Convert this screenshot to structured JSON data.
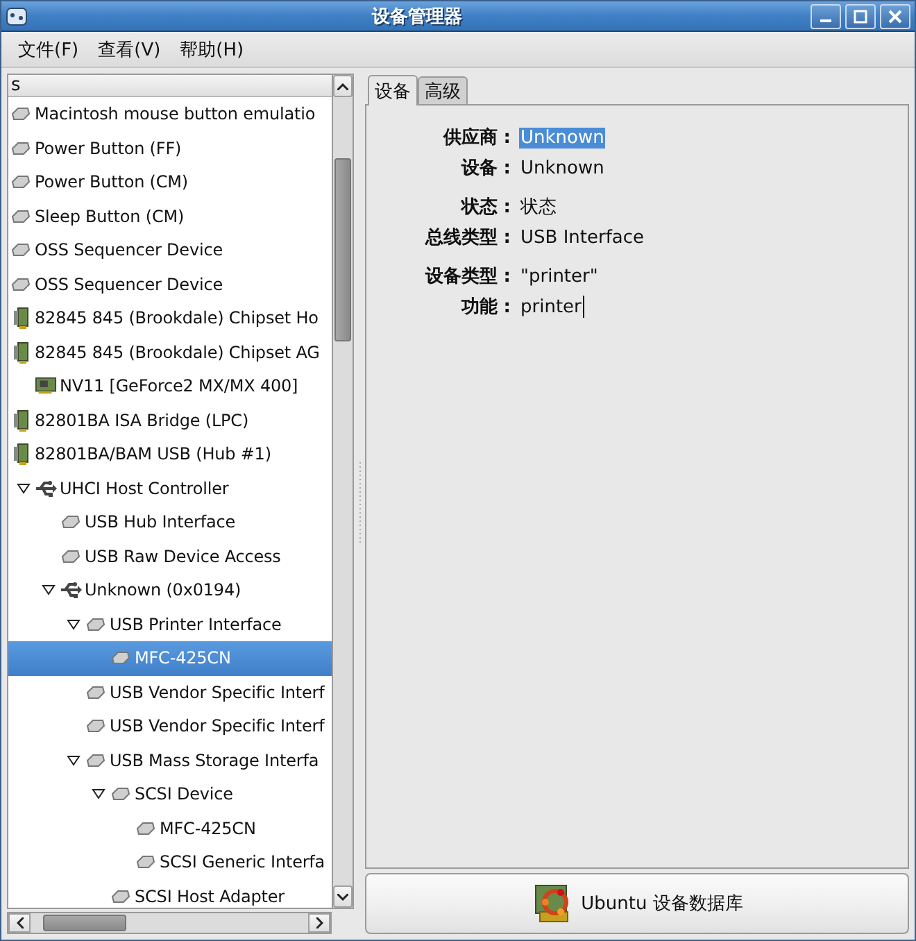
{
  "window": {
    "title": "设备管理器"
  },
  "menu": [
    "文件(F)",
    "查看(V)",
    "帮助(H)"
  ],
  "tree": {
    "column_header": "s",
    "items": [
      {
        "label": "Macintosh mouse button emulatio",
        "kind": "device",
        "selected": false
      },
      {
        "label": "Power Button (FF)",
        "kind": "device",
        "selected": false
      },
      {
        "label": "Power Button (CM)",
        "kind": "device",
        "selected": false
      },
      {
        "label": "Sleep Button (CM)",
        "kind": "device",
        "selected": false
      },
      {
        "label": "OSS Sequencer Device",
        "kind": "device",
        "selected": false
      },
      {
        "label": "OSS Sequencer Device",
        "kind": "device",
        "selected": false
      },
      {
        "label": "82845 845 (Brookdale) Chipset Ho",
        "kind": "chip",
        "selected": false
      },
      {
        "label": "82845 845 (Brookdale) Chipset AG",
        "kind": "chip",
        "selected": false,
        "children": [
          {
            "label": "NV11 [GeForce2 MX/MX 400]",
            "kind": "card",
            "selected": false
          }
        ]
      },
      {
        "label": "82801BA ISA Bridge (LPC)",
        "kind": "chip",
        "selected": false
      },
      {
        "label": "82801BA/BAM USB (Hub #1)",
        "kind": "chip",
        "selected": false,
        "children": [
          {
            "label": "UHCI Host Controller",
            "kind": "usb",
            "selected": false,
            "expanded": true,
            "children": [
              {
                "label": "USB Hub Interface",
                "kind": "device",
                "selected": false
              },
              {
                "label": "USB Raw Device Access",
                "kind": "device",
                "selected": false
              },
              {
                "label": "Unknown (0x0194)",
                "kind": "usb",
                "selected": false,
                "expanded": true,
                "children": [
                  {
                    "label": "USB Printer Interface",
                    "kind": "device",
                    "selected": false,
                    "expanded": true,
                    "children": [
                      {
                        "label": "MFC-425CN",
                        "kind": "device",
                        "selected": true
                      }
                    ]
                  },
                  {
                    "label": "USB Vendor Specific Interf",
                    "kind": "device",
                    "selected": false
                  },
                  {
                    "label": "USB Vendor Specific Interf",
                    "kind": "device",
                    "selected": false
                  },
                  {
                    "label": "USB Mass Storage Interfa",
                    "kind": "device",
                    "selected": false,
                    "expanded": true,
                    "children": [
                      {
                        "label": "SCSI Device",
                        "kind": "device",
                        "selected": false,
                        "expanded": true,
                        "children": [
                          {
                            "label": "MFC-425CN",
                            "kind": "device",
                            "selected": false
                          },
                          {
                            "label": "SCSI Generic Interfa",
                            "kind": "device",
                            "selected": false
                          }
                        ]
                      },
                      {
                        "label": "SCSI Host Adapter",
                        "kind": "device",
                        "selected": false
                      }
                    ]
                  }
                ]
              }
            ]
          }
        ]
      }
    ]
  },
  "tabs": [
    {
      "label": "设备",
      "selected": true
    },
    {
      "label": "高级",
      "selected": false
    }
  ],
  "details": [
    [
      {
        "label": "供应商 :",
        "value": "Unknown",
        "selected": true
      },
      {
        "label": "设备 :",
        "value": "Unknown",
        "selected": false
      }
    ],
    [
      {
        "label": "状态 :",
        "value": "状态",
        "selected": false
      },
      {
        "label": "总线类型 :",
        "value": "USB Interface",
        "selected": false
      }
    ],
    [
      {
        "label": "设备类型 :",
        "value": "\"printer\"",
        "selected": false
      },
      {
        "label": "功能 :",
        "value": "printer",
        "selected": false,
        "caret": true
      }
    ]
  ],
  "database_button": {
    "label": "Ubuntu 设备数据库"
  }
}
